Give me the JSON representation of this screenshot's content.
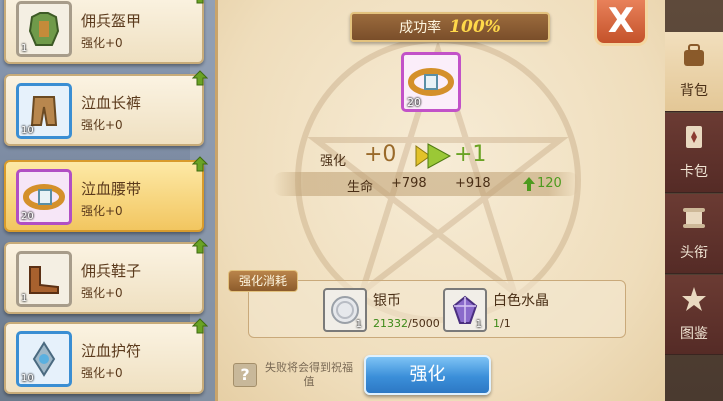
{
  "items": [
    {
      "name": "佣兵盔甲",
      "level": "强化+0",
      "count": "1",
      "frame": "grey",
      "icon": "armor-icon"
    },
    {
      "name": "泣血长裤",
      "level": "强化+0",
      "count": "10",
      "frame": "blue",
      "icon": "pants-icon"
    },
    {
      "name": "泣血腰带",
      "level": "强化+0",
      "count": "20",
      "frame": "purple",
      "icon": "belt-icon",
      "selected": true
    },
    {
      "name": "佣兵鞋子",
      "level": "强化+0",
      "count": "1",
      "frame": "grey",
      "icon": "boots-icon"
    },
    {
      "name": "泣血护符",
      "level": "强化+0",
      "count": "10",
      "frame": "blue",
      "icon": "amulet-icon"
    }
  ],
  "panel": {
    "rate_label": "成功率",
    "rate_value": "100%",
    "target_count": "20",
    "enh_label": "强化",
    "enh_from": "+0",
    "enh_to": "+1",
    "stat_name": "生命",
    "stat_old": "+798",
    "stat_new": "+918",
    "stat_diff": "120",
    "cost_title": "强化消耗",
    "cost": [
      {
        "name": "银币",
        "count": "1",
        "have": "21332",
        "need": "/5000",
        "icon": "silver-coin-icon"
      },
      {
        "name": "白色水晶",
        "count": "1",
        "have": "1",
        "need": "/1",
        "icon": "white-crystal-icon"
      }
    ],
    "help_icon": "?",
    "help_text": "失败将会得到祝福值",
    "button_label": "强化",
    "close_label": "X"
  },
  "tabs": [
    {
      "label": "背包",
      "icon": "backpack-icon",
      "active": true
    },
    {
      "label": "卡包",
      "icon": "card-pack-icon"
    },
    {
      "label": "头衔",
      "icon": "title-scroll-icon"
    },
    {
      "label": "图鉴",
      "icon": "codex-star-icon"
    }
  ],
  "colors": {
    "up_green": "#6aa324",
    "selected_item": "#f2c660",
    "button_blue": "#3b8fd9"
  }
}
